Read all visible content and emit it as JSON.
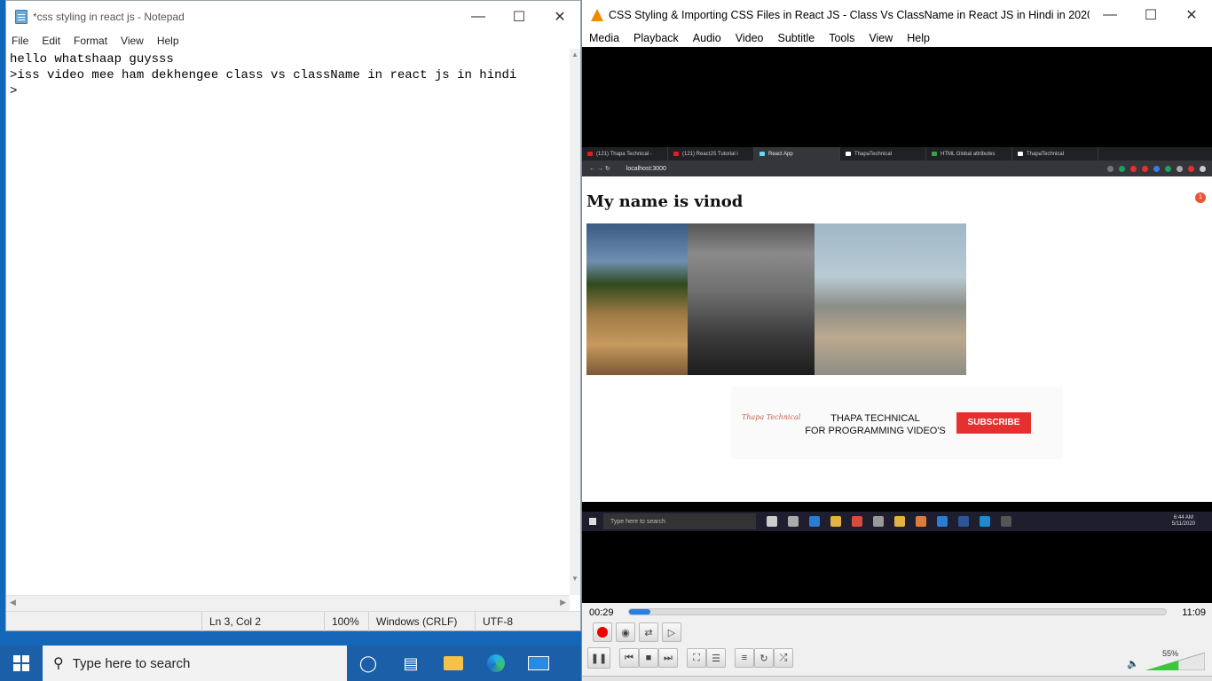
{
  "notepad": {
    "title": "*css styling in react js - Notepad",
    "menu": [
      "File",
      "Edit",
      "Format",
      "View",
      "Help"
    ],
    "lines": [
      "hello whatshaap guysss",
      ">iss video mee ham dekhengee class vs className in react js in hindi",
      ">"
    ],
    "status": {
      "position": "Ln 3, Col 2",
      "zoom": "100%",
      "line_endings": "Windows (CRLF)",
      "encoding": "UTF-8"
    }
  },
  "vlc": {
    "title": "CSS Styling & Importing CSS Files in React JS - Class Vs ClassName in React JS in Hindi in 2020 #14.m...",
    "menu": [
      "Media",
      "Playback",
      "Audio",
      "Video",
      "Subtitle",
      "Tools",
      "View",
      "Help"
    ],
    "elapsed": "00:29",
    "total": "11:09",
    "progress": 0.04,
    "volume_label": "55%",
    "volume": 0.55
  },
  "browser": {
    "tabs": [
      {
        "label": "(121) Thapa Technical -",
        "fav": "#e02020"
      },
      {
        "label": "(121) ReactJS Tutorial i",
        "fav": "#e02020"
      },
      {
        "label": "React App",
        "fav": "#61dafb",
        "active": true
      },
      {
        "label": "ThapaTechnical",
        "fav": "#ffffff"
      },
      {
        "label": "HTML Global attributes",
        "fav": "#3ca24a"
      },
      {
        "label": "ThapaTechnical",
        "fav": "#ffffff"
      }
    ],
    "url": "localhost:3000",
    "heading": "My name is vinod",
    "badge": "1",
    "promo": {
      "logo": "Thapa Technical",
      "line1": "THAPA TECHNICAL",
      "line2": "FOR PROGRAMMING VIDEO'S",
      "button": "SUBSCRIBE"
    },
    "taskbar": {
      "search": "Type here to search",
      "time": "6:44 AM",
      "date": "5/11/2020"
    }
  },
  "taskbar": {
    "search_placeholder": "Type here to search"
  }
}
